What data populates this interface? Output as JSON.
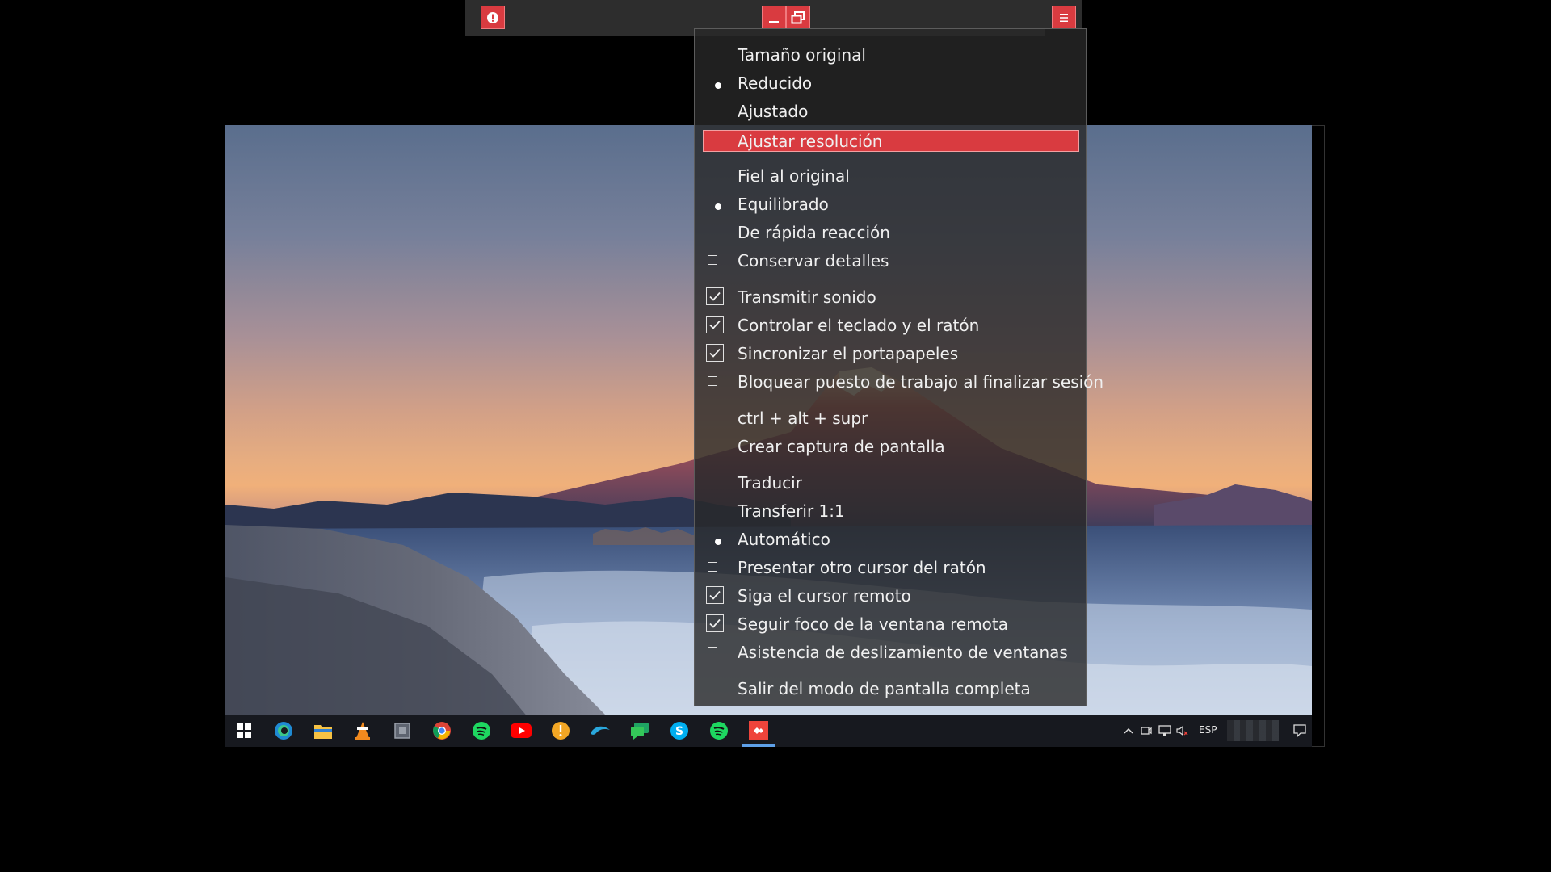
{
  "toolbar": {
    "info_icon": "exclamation-icon",
    "minimize_icon": "minimize-icon",
    "restore_icon": "restore-window-icon",
    "menu_icon": "hamburger-menu-icon",
    "accent": "#d93b40"
  },
  "menu": {
    "items": [
      {
        "label": "Tamaño original",
        "mark": "none"
      },
      {
        "label": "Reducido",
        "mark": "dot"
      },
      {
        "label": "Ajustado",
        "mark": "none"
      },
      {
        "label": "Ajustar resolución",
        "mark": "none",
        "highlighted": true
      },
      {
        "label": "Fiel al original",
        "mark": "none"
      },
      {
        "label": "Equilibrado",
        "mark": "dot"
      },
      {
        "label": "De rápida reacción",
        "mark": "none"
      },
      {
        "label": "Conservar detalles",
        "mark": "box"
      },
      {
        "label": "Transmitir sonido",
        "mark": "check"
      },
      {
        "label": "Controlar el teclado y el ratón",
        "mark": "check"
      },
      {
        "label": "Sincronizar el portapapeles",
        "mark": "check"
      },
      {
        "label": "Bloquear puesto de trabajo al finalizar sesión",
        "mark": "box"
      },
      {
        "label": "ctrl + alt + supr",
        "mark": "none"
      },
      {
        "label": "Crear captura de pantalla",
        "mark": "none"
      },
      {
        "label": "Traducir",
        "mark": "none"
      },
      {
        "label": "Transferir 1:1",
        "mark": "none"
      },
      {
        "label": "Automático",
        "mark": "dot"
      },
      {
        "label": "Presentar otro cursor del ratón",
        "mark": "box"
      },
      {
        "label": "Siga el cursor remoto",
        "mark": "check"
      },
      {
        "label": "Seguir foco de la ventana remota",
        "mark": "check"
      },
      {
        "label": "Asistencia de deslizamiento de ventanas",
        "mark": "box"
      },
      {
        "label": "Salir del modo de pantalla completa",
        "mark": "none"
      }
    ]
  },
  "taskbar": {
    "apps": [
      "windows-start-icon",
      "edge-icon",
      "file-explorer-icon",
      "vlc-icon",
      "generic-app-icon",
      "chrome-icon",
      "spotify-icon",
      "youtube-icon",
      "info-app-icon",
      "dolphin-icon",
      "messages-icon",
      "skype-icon",
      "spotify-icon",
      "anydesk-icon"
    ],
    "tray": {
      "language": "ESP"
    }
  }
}
